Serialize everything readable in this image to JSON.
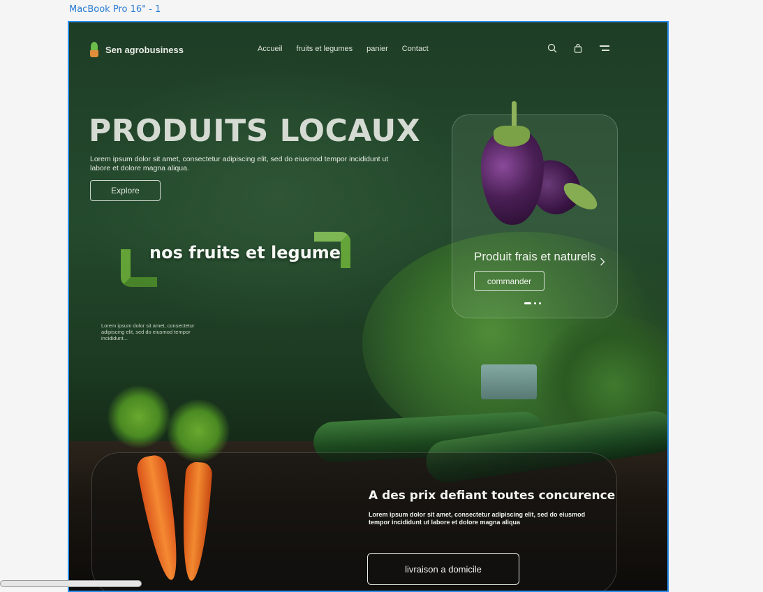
{
  "frame": {
    "label": "MacBook Pro 16\" - 1"
  },
  "nav": {
    "brand": "Sen agrobusiness",
    "links": [
      "Accueil",
      "fruits et legumes",
      "panier",
      "Contact"
    ],
    "icons": [
      "search-icon",
      "shopping-bag-icon",
      "menu-icon"
    ]
  },
  "hero": {
    "title": "PRODUITS LOCAUX",
    "text": "Lorem ipsum dolor sit amet, consectetur adipiscing elit, sed do eiusmod tempor incididunt ut labore et dolore magna aliqua.",
    "button": "Explore"
  },
  "section": {
    "title": "nos fruits et legume",
    "text": "Lorem ipsum dolor sit amet, consectetur adipiscing elit, sed do eiusmod tempor incididunt..."
  },
  "product_card": {
    "title": "Produit frais et naturels",
    "button": "commander"
  },
  "promo_card": {
    "title": "A des prix defiant  toutes concurence",
    "text": "Lorem ipsum dolor sit amet, consectetur adipiscing elit, sed do eiusmod tempor incididunt ut labore et dolore magna aliqua",
    "button": "livraison a domicile"
  },
  "colors": {
    "accent_green": "#6fb33a",
    "frame_border": "#2d8ff0",
    "label_blue": "#2b7cd3"
  }
}
